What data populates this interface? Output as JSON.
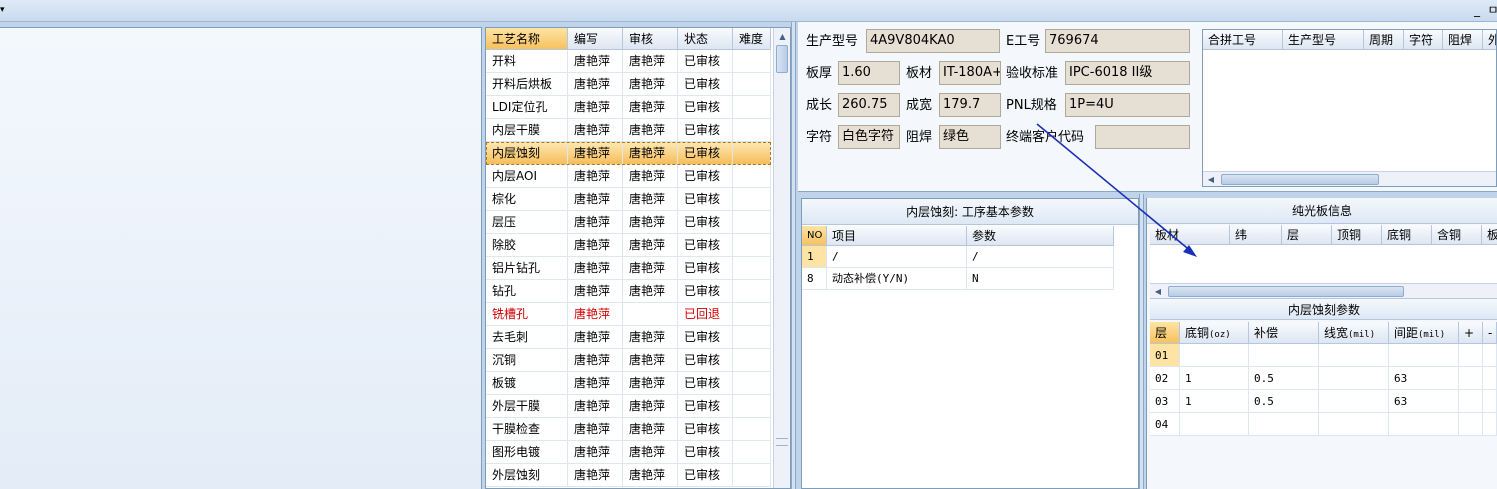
{
  "topbar": {
    "combo_arrow": "▾",
    "minimize_glyph": "_",
    "restore_glyph": "ㅁ"
  },
  "process_grid": {
    "columns": [
      "工艺名称",
      "编写",
      "审核",
      "状态",
      "难度"
    ],
    "rows": [
      {
        "name": "开料",
        "writer": "唐艳萍",
        "reviewer": "唐艳萍",
        "status": "已审核",
        "difficulty": ""
      },
      {
        "name": "开料后烘板",
        "writer": "唐艳萍",
        "reviewer": "唐艳萍",
        "status": "已审核",
        "difficulty": ""
      },
      {
        "name": "LDI定位孔",
        "writer": "唐艳萍",
        "reviewer": "唐艳萍",
        "status": "已审核",
        "difficulty": ""
      },
      {
        "name": "内层干膜",
        "writer": "唐艳萍",
        "reviewer": "唐艳萍",
        "status": "已审核",
        "difficulty": ""
      },
      {
        "name": "内层蚀刻",
        "writer": "唐艳萍",
        "reviewer": "唐艳萍",
        "status": "已审核",
        "difficulty": ""
      },
      {
        "name": "内层AOI",
        "writer": "唐艳萍",
        "reviewer": "唐艳萍",
        "status": "已审核",
        "difficulty": ""
      },
      {
        "name": "棕化",
        "writer": "唐艳萍",
        "reviewer": "唐艳萍",
        "status": "已审核",
        "difficulty": ""
      },
      {
        "name": "层压",
        "writer": "唐艳萍",
        "reviewer": "唐艳萍",
        "status": "已审核",
        "difficulty": ""
      },
      {
        "name": "除胶",
        "writer": "唐艳萍",
        "reviewer": "唐艳萍",
        "status": "已审核",
        "difficulty": ""
      },
      {
        "name": "铝片钻孔",
        "writer": "唐艳萍",
        "reviewer": "唐艳萍",
        "status": "已审核",
        "difficulty": ""
      },
      {
        "name": "钻孔",
        "writer": "唐艳萍",
        "reviewer": "唐艳萍",
        "status": "已审核",
        "difficulty": ""
      },
      {
        "name": "铣槽孔",
        "writer": "唐艳萍",
        "reviewer": "",
        "status": "已回退",
        "difficulty": ""
      },
      {
        "name": "去毛刺",
        "writer": "唐艳萍",
        "reviewer": "唐艳萍",
        "status": "已审核",
        "difficulty": ""
      },
      {
        "name": "沉铜",
        "writer": "唐艳萍",
        "reviewer": "唐艳萍",
        "status": "已审核",
        "difficulty": ""
      },
      {
        "name": "板镀",
        "writer": "唐艳萍",
        "reviewer": "唐艳萍",
        "status": "已审核",
        "difficulty": ""
      },
      {
        "name": "外层干膜",
        "writer": "唐艳萍",
        "reviewer": "唐艳萍",
        "status": "已审核",
        "difficulty": ""
      },
      {
        "name": "干膜检查",
        "writer": "唐艳萍",
        "reviewer": "唐艳萍",
        "status": "已审核",
        "difficulty": ""
      },
      {
        "name": "图形电镀",
        "writer": "唐艳萍",
        "reviewer": "唐艳萍",
        "status": "已审核",
        "difficulty": ""
      },
      {
        "name": "外层蚀刻",
        "writer": "唐艳萍",
        "reviewer": "唐艳萍",
        "status": "已审核",
        "difficulty": ""
      }
    ]
  },
  "product_info": {
    "model_label": "生产型号",
    "model_value": "4A9V804KA0",
    "e_label": "E工号",
    "e_value": "769674",
    "thickness_label": "板厚",
    "thickness_value": "1.60",
    "material_label": "板材",
    "material_value": "IT-180A+",
    "standard_label": "验收标准",
    "standard_value": "IPC-6018 II级",
    "length_label": "成长",
    "length_value": "260.75",
    "width_label": "成宽",
    "width_value": "179.7",
    "pnl_label": "PNL规格",
    "pnl_value": "1P=4U",
    "silk_label": "字符",
    "silk_value": "白色字符",
    "mask_label": "阻焊",
    "mask_value": "绿色",
    "customer_label": "终端客户代码",
    "customer_value": ""
  },
  "combo_grid": {
    "columns": [
      "合拼工号",
      "生产型号",
      "周期",
      "字符",
      "阻焊",
      "外"
    ]
  },
  "params_panel": {
    "title": "内层蚀刻: 工序基本参数",
    "columns": [
      "NO",
      "项目",
      "参数"
    ],
    "rows": [
      {
        "no": "1",
        "item": "/",
        "value": "/"
      },
      {
        "no": "8",
        "item": "动态补偿(Y/N)",
        "value": "N"
      }
    ]
  },
  "bare_board": {
    "title": "纯光板信息",
    "columns": [
      "板材",
      "纬",
      "层",
      "顶铜",
      "底铜",
      "含铜",
      "板"
    ]
  },
  "etch_params": {
    "title": "内层蚀刻参数",
    "columns": [
      {
        "label": "层",
        "unit": ""
      },
      {
        "label": "底铜",
        "unit": "(oz)"
      },
      {
        "label": "补偿",
        "unit": ""
      },
      {
        "label": "线宽",
        "unit": "(mil)"
      },
      {
        "label": "间距",
        "unit": "(mil)"
      },
      {
        "label": "+",
        "unit": ""
      },
      {
        "label": "-",
        "unit": ""
      }
    ],
    "rows": [
      {
        "layer": "01",
        "base_cu": "",
        "comp": "",
        "line": "",
        "space": ""
      },
      {
        "layer": "02",
        "base_cu": "1",
        "comp": "0.5",
        "line": "",
        "space": "63"
      },
      {
        "layer": "03",
        "base_cu": "1",
        "comp": "0.5",
        "line": "",
        "space": "63"
      },
      {
        "layer": "04",
        "base_cu": "",
        "comp": "",
        "line": "",
        "space": ""
      }
    ]
  },
  "colors": {
    "selection": "#f7c15e",
    "rejected_text": "#d00000",
    "annotation_arrow": "#1a2fb8"
  }
}
